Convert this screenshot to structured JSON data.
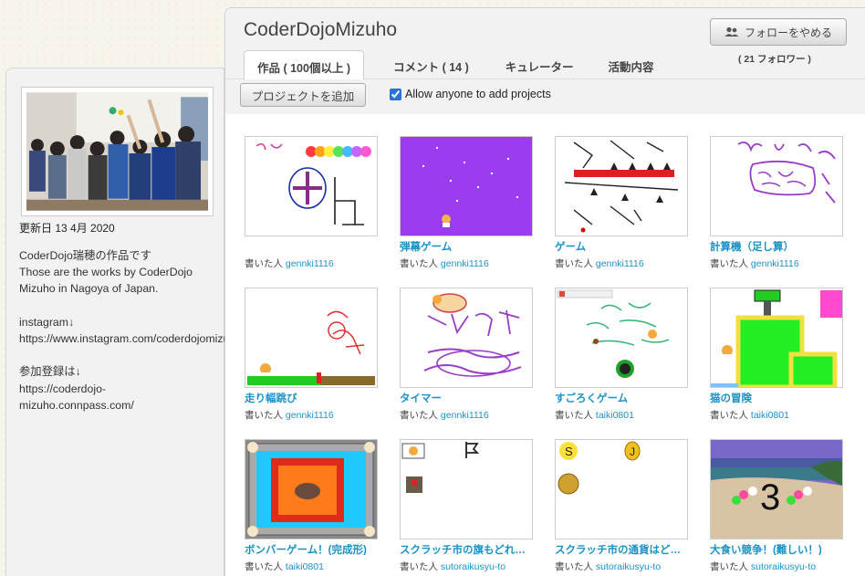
{
  "profile": {
    "updated": "更新日 13 4月 2020",
    "bio": "CoderDojo瑞穂の作品です\nThose are the works by CoderDojo Mizuho in Nagoya of Japan.\n\ninstagram↓\nhttps://www.instagram.com/coderdojomizuho/\n\n参加登録は↓\nhttps://coderdojo-mizuho.connpass.com/"
  },
  "studio": {
    "title": "CoderDojoMizuho",
    "follow_button": "フォローをやめる",
    "followers": "( 21 フォロワー )",
    "tabs": [
      {
        "label": "作品 ( 100個以上 )",
        "active": true
      },
      {
        "label": "コメント ( 14 )",
        "active": false
      },
      {
        "label": "キュレーター",
        "active": false
      },
      {
        "label": "活動内容",
        "active": false
      }
    ],
    "add_project_button": "プロジェクトを追加",
    "allow_label": "Allow anyone to add projects",
    "allow_checked": true
  },
  "author_prefix": "書いた人",
  "projects": [
    {
      "title": "",
      "author": "gennki1116",
      "thumb": "doodle-cat"
    },
    {
      "title": "弾幕ゲーム",
      "author": "gennki1116",
      "thumb": "purple-stars"
    },
    {
      "title": "ゲーム",
      "author": "gennki1116",
      "thumb": "maze-spikes"
    },
    {
      "title": "計算機（足し算）",
      "author": "gennki1116",
      "thumb": "calc-scribble"
    },
    {
      "title": "走り幅跳び",
      "author": "gennki1116",
      "thumb": "long-jump"
    },
    {
      "title": "タイマー",
      "author": "gennki1116",
      "thumb": "timer-scribble"
    },
    {
      "title": "すごろくゲーム",
      "author": "taiki0801",
      "thumb": "sugoroku"
    },
    {
      "title": "猫の冒険",
      "author": "taiki0801",
      "thumb": "cat-adventure"
    },
    {
      "title": "ボンバーゲーム！(完成形)",
      "author": "taiki0801",
      "thumb": "bomber"
    },
    {
      "title": "スクラッチ市の旗もどれ…",
      "author": "sutoraikusyu-to",
      "thumb": "flag-return"
    },
    {
      "title": "スクラッチ市の通貨はど…",
      "author": "sutoraikusyu-to",
      "thumb": "coins"
    },
    {
      "title": "大食い競争！(難しい！)",
      "author": "sutoraikusyu-to",
      "thumb": "beach-3"
    }
  ]
}
